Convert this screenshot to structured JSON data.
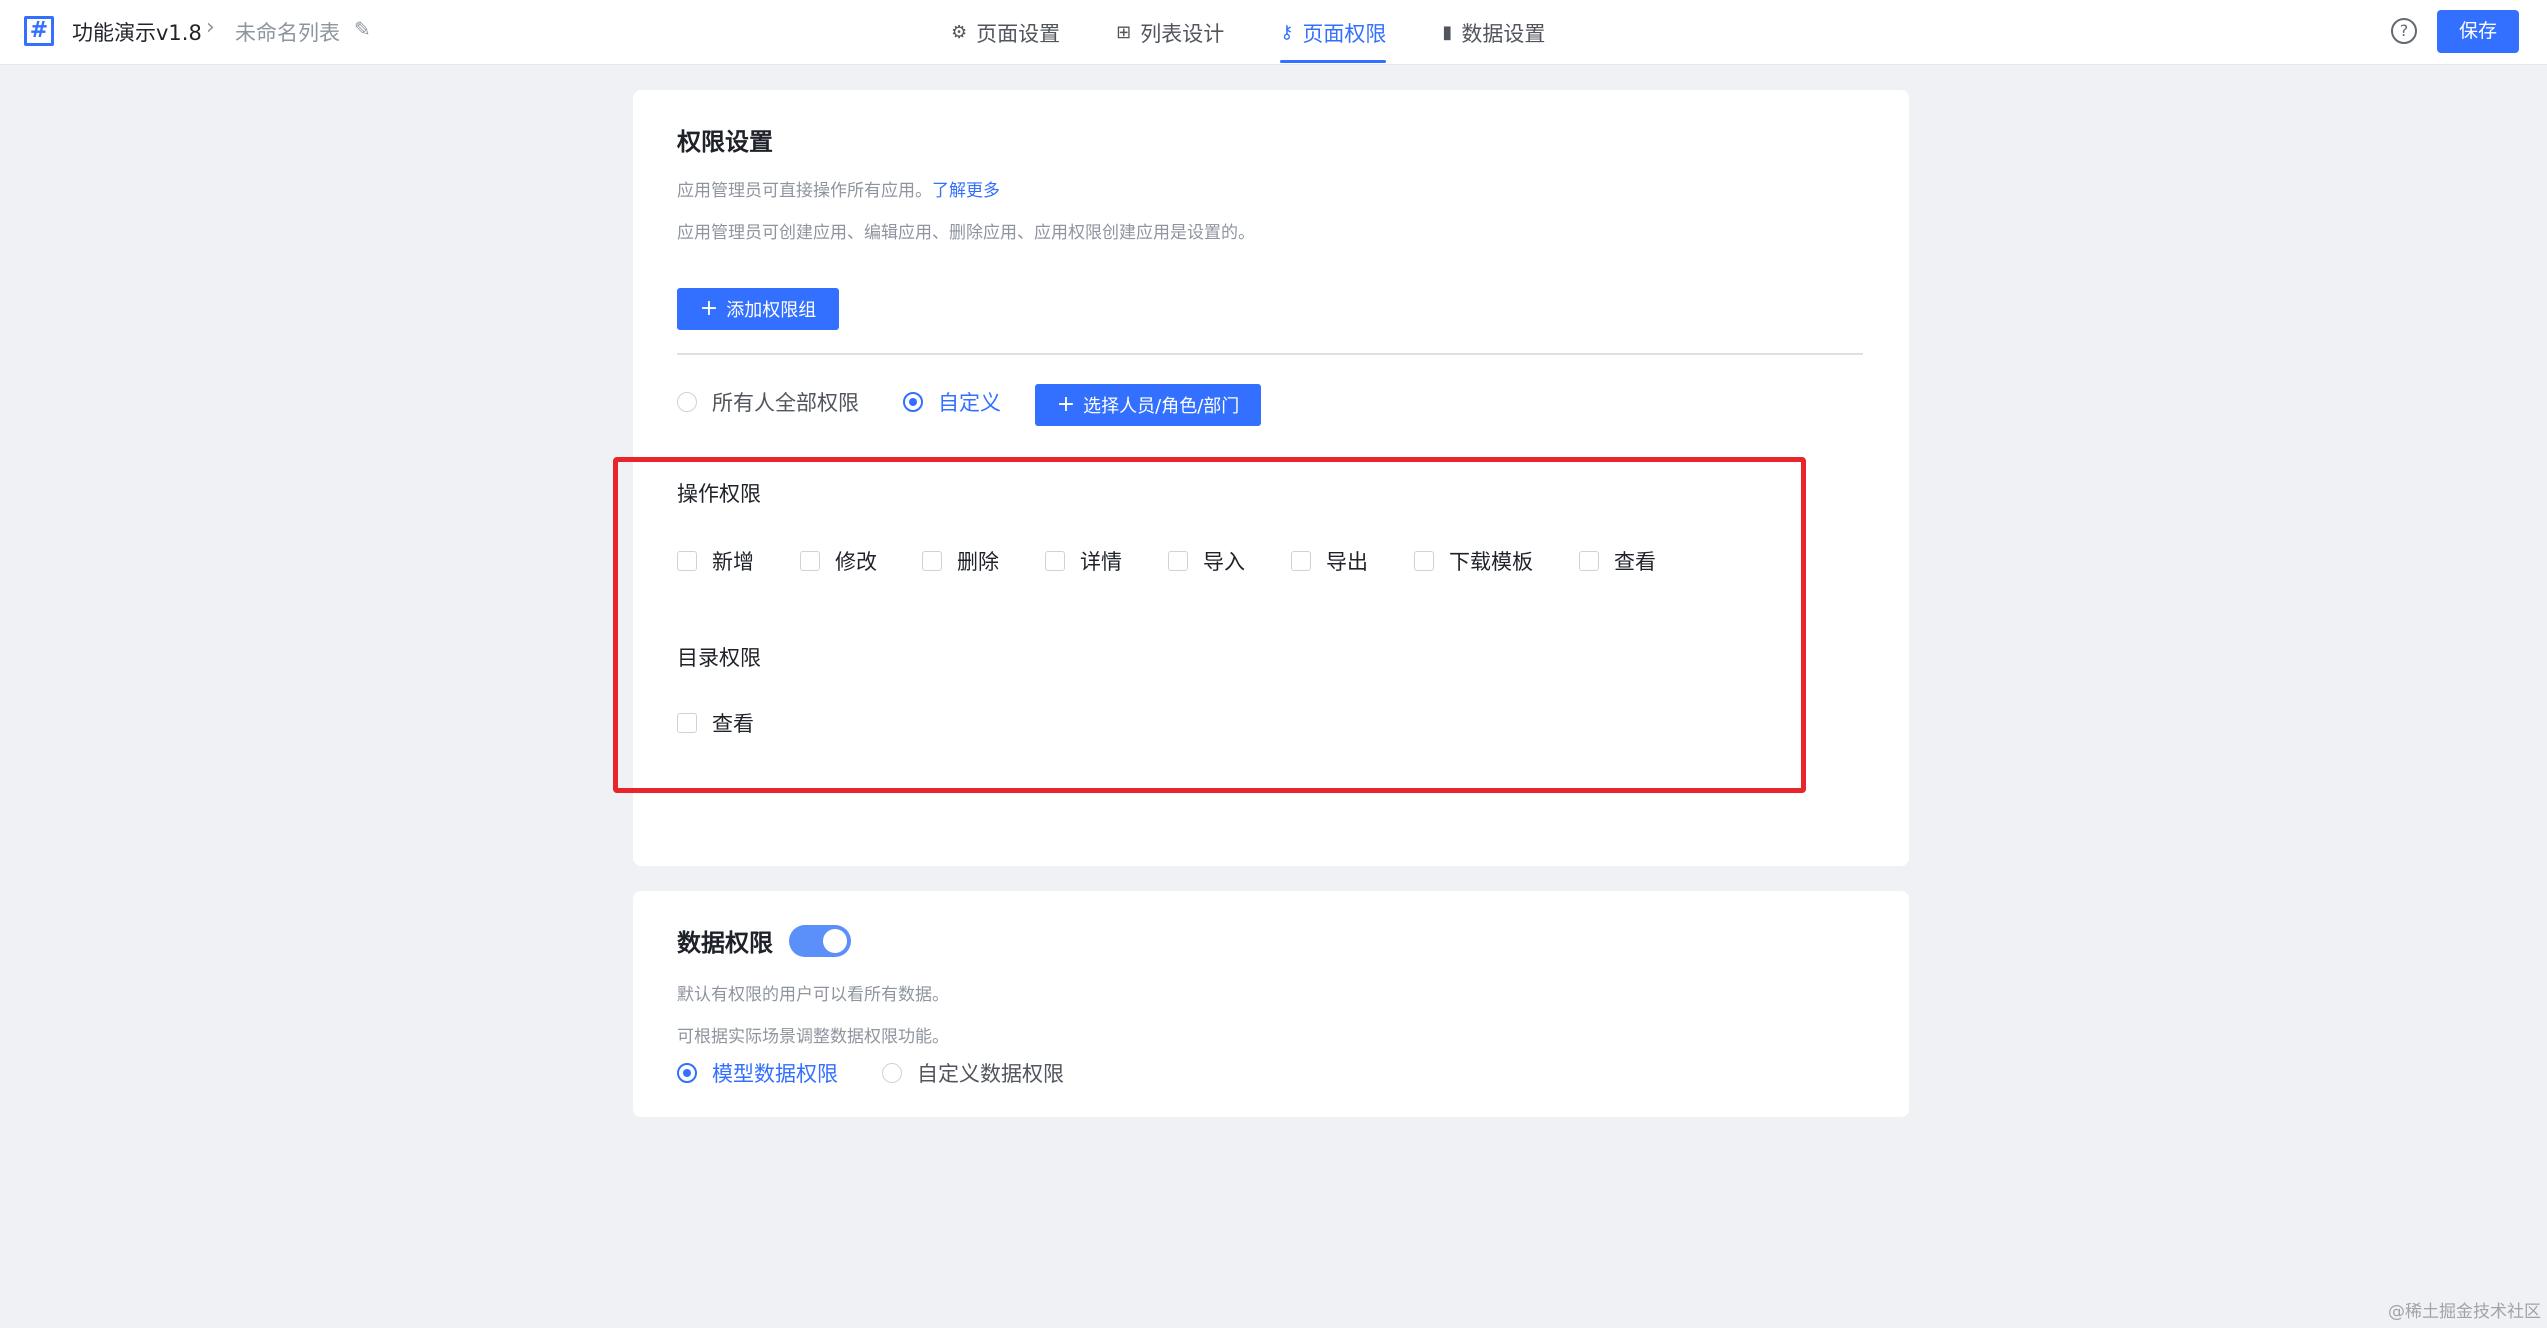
{
  "header": {
    "app_title": "功能演示v1.8",
    "page_name": "未命名列表",
    "tabs": [
      {
        "label": "页面设置",
        "icon": "gear-icon",
        "active": false
      },
      {
        "label": "列表设计",
        "icon": "table-icon",
        "active": false
      },
      {
        "label": "页面权限",
        "icon": "key-icon",
        "active": true
      },
      {
        "label": "数据设置",
        "icon": "bar-chart-icon",
        "active": false
      }
    ],
    "save_label": "保存"
  },
  "permission": {
    "title": "权限设置",
    "hint1_text": "应用管理员可直接操作所有应用。",
    "hint1_link": "了解更多",
    "hint2": "应用管理员可创建应用、编辑应用、删除应用、应用权限创建应用是设置的。",
    "add_group_label": "添加权限组",
    "scope_options": [
      "所有人全部权限",
      "自定义"
    ],
    "scope_selected": "自定义",
    "select_members_label": "选择人员/角色/部门",
    "operation_label": "操作权限",
    "operations": [
      "新增",
      "修改",
      "删除",
      "详情",
      "导入",
      "导出",
      "下载模板",
      "查看"
    ],
    "directory_label": "目录权限",
    "directory_items": [
      "查看"
    ]
  },
  "data_permission": {
    "title": "数据权限",
    "enabled": true,
    "hint1": "默认有权限的用户可以看所有数据。",
    "hint2": "可根据实际场景调整数据权限功能。",
    "options": [
      "模型数据权限",
      "自定义数据权限"
    ],
    "selected": "模型数据权限"
  },
  "watermark": "@稀土掘金技术社区",
  "colors": {
    "accent": "#3370ff",
    "highlight": "#e8252a",
    "background": "#f0f1f5"
  }
}
